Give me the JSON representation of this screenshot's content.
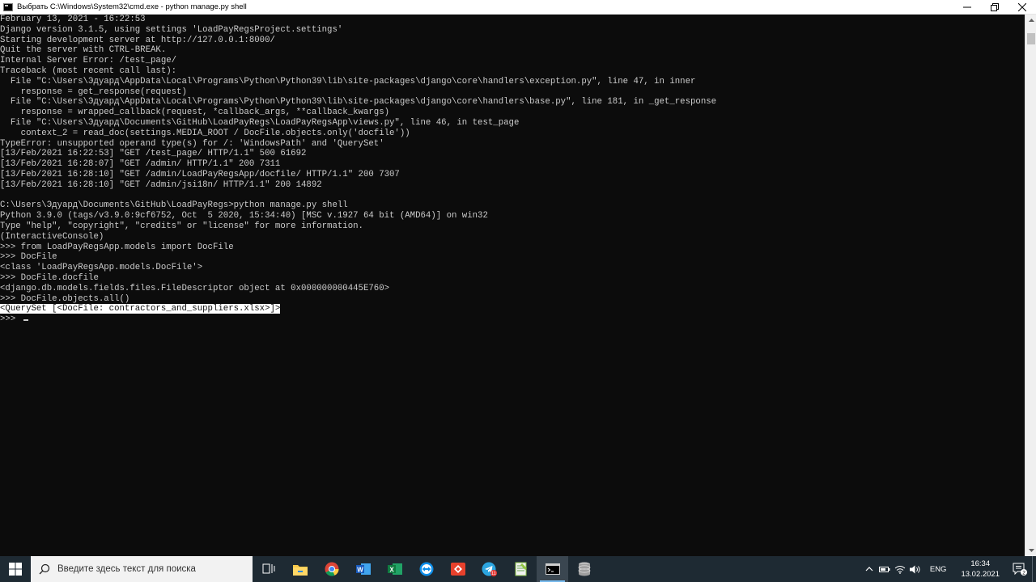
{
  "window": {
    "title": "Выбрать C:\\Windows\\System32\\cmd.exe - python  manage.py shell",
    "controls": {
      "minimize": "—",
      "maximize": "☐",
      "close": "✕"
    }
  },
  "console": {
    "lines": [
      "February 13, 2021 - 16:22:53",
      "Django version 3.1.5, using settings 'LoadPayRegsProject.settings'",
      "Starting development server at http://127.0.0.1:8000/",
      "Quit the server with CTRL-BREAK.",
      "Internal Server Error: /test_page/",
      "Traceback (most recent call last):",
      "  File \"C:\\Users\\Эдуард\\AppData\\Local\\Programs\\Python\\Python39\\lib\\site-packages\\django\\core\\handlers\\exception.py\", line 47, in inner",
      "    response = get_response(request)",
      "  File \"C:\\Users\\Эдуард\\AppData\\Local\\Programs\\Python\\Python39\\lib\\site-packages\\django\\core\\handlers\\base.py\", line 181, in _get_response",
      "    response = wrapped_callback(request, *callback_args, **callback_kwargs)",
      "  File \"C:\\Users\\Эдуард\\Documents\\GitHub\\LoadPayRegs\\LoadPayRegsApp\\views.py\", line 46, in test_page",
      "    context_2 = read_doc(settings.MEDIA_ROOT / DocFile.objects.only('docfile'))",
      "TypeError: unsupported operand type(s) for /: 'WindowsPath' and 'QuerySet'",
      "[13/Feb/2021 16:22:53] \"GET /test_page/ HTTP/1.1\" 500 61692",
      "[13/Feb/2021 16:28:07] \"GET /admin/ HTTP/1.1\" 200 7311",
      "[13/Feb/2021 16:28:10] \"GET /admin/LoadPayRegsApp/docfile/ HTTP/1.1\" 200 7307",
      "[13/Feb/2021 16:28:10] \"GET /admin/jsi18n/ HTTP/1.1\" 200 14892",
      "",
      "C:\\Users\\Эдуард\\Documents\\GitHub\\LoadPayRegs>python manage.py shell",
      "Python 3.9.0 (tags/v3.9.0:9cf6752, Oct  5 2020, 15:34:40) [MSC v.1927 64 bit (AMD64)] on win32",
      "Type \"help\", \"copyright\", \"credits\" or \"license\" for more information.",
      "(InteractiveConsole)",
      ">>> from LoadPayRegsApp.models import DocFile",
      ">>> DocFile",
      "<class 'LoadPayRegsApp.models.DocFile'>",
      ">>> DocFile.docfile",
      "<django.db.models.fields.files.FileDescriptor object at 0x000000000445E760>",
      ">>> DocFile.objects.all()"
    ],
    "selected_line": "<QuerySet [<DocFile: contractors_and_suppliers.xlsx>]>",
    "prompt": ">>> "
  },
  "taskbar": {
    "search_placeholder": "Введите здесь текст для поиска",
    "apps": [
      {
        "name": "task-view-icon"
      },
      {
        "name": "file-explorer-icon"
      },
      {
        "name": "chrome-icon"
      },
      {
        "name": "word-icon"
      },
      {
        "name": "excel-icon"
      },
      {
        "name": "teamviewer-icon"
      },
      {
        "name": "anydesk-icon"
      },
      {
        "name": "telegram-icon"
      },
      {
        "name": "notepad-plus-plus-icon"
      },
      {
        "name": "cmd-icon"
      },
      {
        "name": "database-icon"
      }
    ],
    "telegram_badge": "11",
    "language": "ENG",
    "time": "16:34",
    "date": "13.02.2021",
    "notification_count": "2"
  },
  "colors": {
    "console_bg": "#0c0c0c",
    "console_text": "#cccccc",
    "taskbar_bg": "#1e2a33",
    "accent": "#76b9ed"
  }
}
